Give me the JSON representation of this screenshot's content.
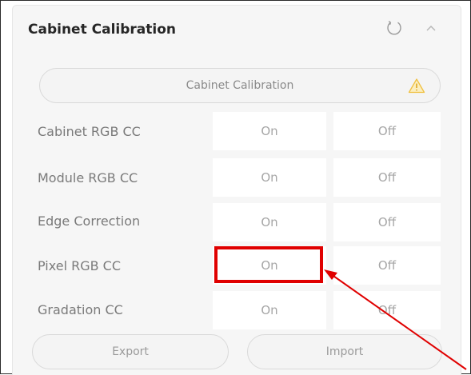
{
  "panel": {
    "title": "Cabinet Calibration",
    "calibration_button_label": "Cabinet Calibration"
  },
  "rows": [
    {
      "label": "Cabinet RGB CC",
      "on": "On",
      "off": "Off"
    },
    {
      "label": "Module RGB CC",
      "on": "On",
      "off": "Off"
    },
    {
      "label": "Edge Correction",
      "on": "On",
      "off": "Off"
    },
    {
      "label": "Pixel RGB CC",
      "on": "On",
      "off": "Off"
    },
    {
      "label": "Gradation CC",
      "on": "On",
      "off": "Off"
    }
  ],
  "footer": {
    "export_label": "Export",
    "import_label": "Import"
  },
  "icons": {
    "refresh": "refresh-icon",
    "collapse": "chevron-up-icon",
    "warning": "warning-icon"
  },
  "colors": {
    "annotation": "#e00000",
    "warning": "#f0c040"
  }
}
